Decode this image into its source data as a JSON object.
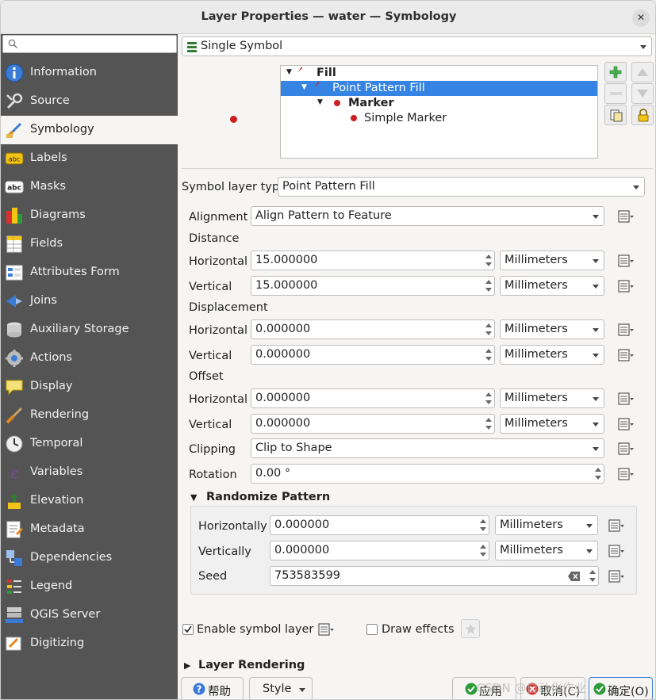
{
  "window": {
    "title": "Layer Properties — water — Symbology"
  },
  "sidebar": {
    "search_placeholder": "",
    "items": [
      {
        "label": "Information",
        "icon": "information-icon"
      },
      {
        "label": "Source",
        "icon": "source-icon"
      },
      {
        "label": "Symbology",
        "icon": "symbology-icon",
        "active": true
      },
      {
        "label": "Labels",
        "icon": "labels-icon"
      },
      {
        "label": "Masks",
        "icon": "masks-icon"
      },
      {
        "label": "Diagrams",
        "icon": "diagrams-icon"
      },
      {
        "label": "Fields",
        "icon": "fields-icon"
      },
      {
        "label": "Attributes Form",
        "icon": "attributes-form-icon"
      },
      {
        "label": "Joins",
        "icon": "joins-icon"
      },
      {
        "label": "Auxiliary Storage",
        "icon": "auxiliary-storage-icon"
      },
      {
        "label": "Actions",
        "icon": "actions-icon"
      },
      {
        "label": "Display",
        "icon": "display-icon"
      },
      {
        "label": "Rendering",
        "icon": "rendering-icon"
      },
      {
        "label": "Temporal",
        "icon": "temporal-icon"
      },
      {
        "label": "Variables",
        "icon": "variables-icon"
      },
      {
        "label": "Elevation",
        "icon": "elevation-icon"
      },
      {
        "label": "Metadata",
        "icon": "metadata-icon"
      },
      {
        "label": "Dependencies",
        "icon": "dependencies-icon"
      },
      {
        "label": "Legend",
        "icon": "legend-icon"
      },
      {
        "label": "QGIS Server",
        "icon": "qgis-server-icon"
      },
      {
        "label": "Digitizing",
        "icon": "digitizing-icon"
      }
    ]
  },
  "renderer": {
    "type": "Single Symbol"
  },
  "symbol_tree": {
    "rows": [
      {
        "label": "Fill",
        "bold": true,
        "selected": false
      },
      {
        "label": "Point Pattern Fill",
        "bold": false,
        "selected": true
      },
      {
        "label": "Marker",
        "bold": true,
        "selected": false
      },
      {
        "label": "Simple Marker",
        "bold": false,
        "selected": false
      }
    ]
  },
  "symbol_layer_type": {
    "label": "Symbol layer type",
    "value": "Point Pattern Fill"
  },
  "form": {
    "alignment": {
      "label": "Alignment",
      "value": "Align Pattern to Feature"
    },
    "distance_header": "Distance",
    "distance_h": {
      "label": "Horizontal",
      "value": "15.000000",
      "unit": "Millimeters"
    },
    "distance_v": {
      "label": "Vertical",
      "value": "15.000000",
      "unit": "Millimeters"
    },
    "displacement_header": "Displacement",
    "displacement_h": {
      "label": "Horizontal",
      "value": "0.000000",
      "unit": "Millimeters"
    },
    "displacement_v": {
      "label": "Vertical",
      "value": "0.000000",
      "unit": "Millimeters"
    },
    "offset_header": "Offset",
    "offset_h": {
      "label": "Horizontal",
      "value": "0.000000",
      "unit": "Millimeters"
    },
    "offset_v": {
      "label": "Vertical",
      "value": "0.000000",
      "unit": "Millimeters"
    },
    "clipping": {
      "label": "Clipping",
      "value": "Clip to Shape"
    },
    "rotation": {
      "label": "Rotation",
      "value": "0.00 °"
    }
  },
  "randomize": {
    "title": "Randomize Pattern",
    "horizontally": {
      "label": "Horizontally",
      "value": "0.000000",
      "unit": "Millimeters"
    },
    "vertically": {
      "label": "Vertically",
      "value": "0.000000",
      "unit": "Millimeters"
    },
    "seed": {
      "label": "Seed",
      "value": "753583599"
    }
  },
  "options": {
    "enable_symbol_layer": {
      "label": "Enable symbol layer",
      "checked": true
    },
    "draw_effects": {
      "label": "Draw effects",
      "checked": false
    }
  },
  "layer_rendering": {
    "title": "Layer Rendering"
  },
  "buttons": {
    "help": "帮助",
    "style": "Style",
    "apply": "应用",
    "cancel": "取消(C)",
    "ok": "确定(O)"
  },
  "watermark": "CSDN @自动化作业"
}
